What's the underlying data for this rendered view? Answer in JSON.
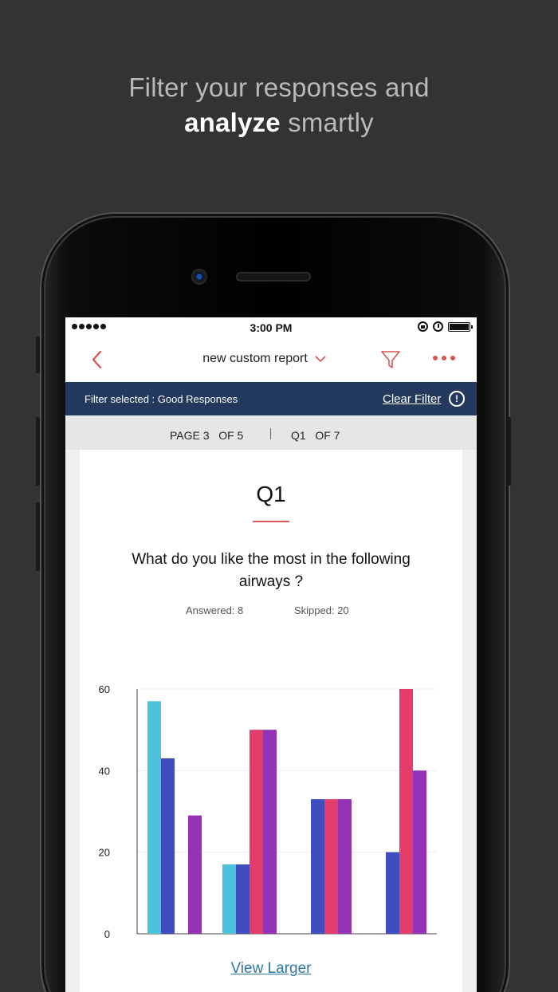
{
  "headline": {
    "line1": "Filter your responses and",
    "strong": "analyze",
    "rest": " smartly"
  },
  "status_bar": {
    "time": "3:00 PM"
  },
  "navbar": {
    "title": "new custom report"
  },
  "filter_bar": {
    "text": "Filter selected : Good Responses",
    "clear_label": "Clear Filter",
    "info_glyph": "!"
  },
  "pager": {
    "page_label": "PAGE 3   OF 5",
    "question_label": "Q1   OF 7"
  },
  "question": {
    "number": "Q1",
    "text": "What do you like the most in the following airways ?",
    "answered": "Answered: 8",
    "skipped": "Skipped: 20"
  },
  "view_larger": "View Larger",
  "colors": {
    "accent": "#d9534f",
    "filter_bar": "#23395d",
    "link": "#2e78a8"
  },
  "chart_data": {
    "type": "bar",
    "categories": [
      "",
      "",
      "",
      ""
    ],
    "series": [
      {
        "color": "#4ec1dc",
        "values": [
          57,
          17,
          0,
          0
        ]
      },
      {
        "color": "#3f4dbf",
        "values": [
          43,
          17,
          33,
          20
        ]
      },
      {
        "color": "#e23d6b",
        "values": [
          0,
          50,
          33,
          60
        ]
      },
      {
        "color": "#9432b5",
        "values": [
          29,
          50,
          33,
          40
        ]
      }
    ],
    "yticks": [
      "0",
      "20",
      "40",
      "60"
    ],
    "ylim": [
      0,
      60
    ],
    "grid": true,
    "title": "",
    "xlabel": "",
    "ylabel": ""
  }
}
